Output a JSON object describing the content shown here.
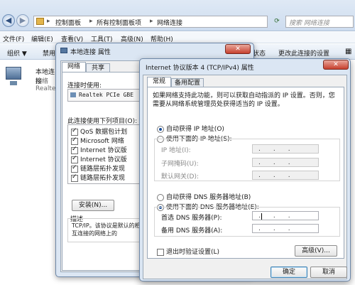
{
  "explorer": {
    "breadcrumb": [
      "控制面板",
      "所有控制面板项",
      "网络连接"
    ],
    "search_placeholder": "搜索 网络连接",
    "menu": [
      "文件(F)",
      "编辑(E)",
      "查看(V)",
      "工具(T)",
      "高级(N)",
      "帮助(H)"
    ],
    "toolbar": {
      "organize": "组织 ▼",
      "disable": "禁用",
      "status": "状态",
      "rename": "更改此连接的设置"
    },
    "adapter": {
      "name": "本地连接",
      "line2": "网络",
      "line3": "Realte"
    }
  },
  "props": {
    "title": "本地连接 属性",
    "tabs": [
      "网络",
      "共享"
    ],
    "connect_using_label": "连接时使用:",
    "adapter": "Realtek PCIe GBE",
    "items_label": "此连接使用下列项目(O):",
    "items": [
      {
        "label": "QoS 数据包计划",
        "checked": true
      },
      {
        "label": "Microsoft 网络",
        "checked": true
      },
      {
        "label": "Internet 协议版",
        "checked": true
      },
      {
        "label": "Internet 协议版",
        "checked": true
      },
      {
        "label": "链路层拓扑发现",
        "checked": true
      },
      {
        "label": "链路层拓扑发现",
        "checked": true
      }
    ],
    "install_button": "安装(N)...",
    "desc_label": "描述",
    "desc_text": "TCP/IP。该协议是默认的相互连接的网络上的"
  },
  "ipv4": {
    "title": "Internet 协议版本 4 (TCP/IPv4) 属性",
    "tabs": [
      "常规",
      "备用配置"
    ],
    "intro": "如果网络支持此功能，则可以获取自动指派的 IP 设置。否则，您需要从网络系统管理员处获得适当的 IP 设置。",
    "auto_ip": "自动获得 IP 地址(O)",
    "manual_ip": "使用下面的 IP 地址(S):",
    "ip_label": "IP 地址(I):",
    "mask_label": "子网掩码(U):",
    "gateway_label": "默认网关(D):",
    "auto_dns": "自动获得 DNS 服务器地址(B)",
    "manual_dns": "使用下面的 DNS 服务器地址(E):",
    "preferred_dns": "首选 DNS 服务器(P):",
    "alternate_dns": "备用 DNS 服务器(A):",
    "validate": "退出时验证设置(L)",
    "advanced": "高级(V)...",
    "ok": "确定",
    "cancel": "取消"
  }
}
